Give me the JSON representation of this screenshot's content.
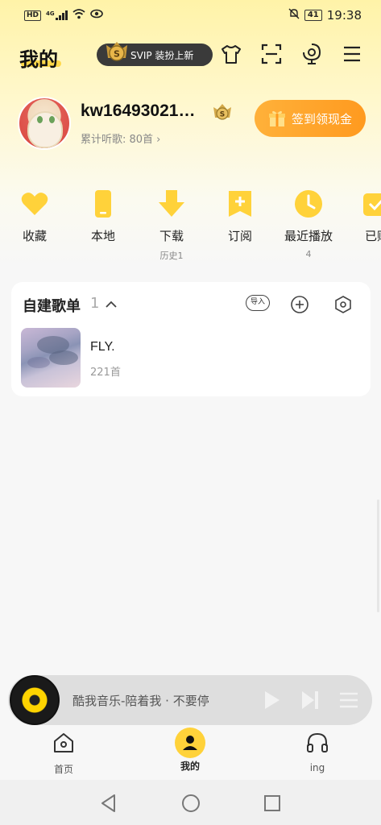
{
  "status_bar": {
    "left_icons": [
      "hd-icon",
      "4g-signal-icon",
      "wifi-icon",
      "eye-icon"
    ],
    "network_label": "4G",
    "hd_label": "HD",
    "battery": "41",
    "time": "19:38"
  },
  "header": {
    "title": "我的",
    "svip_promo": "SVIP 装扮上新",
    "icons": [
      "tshirt-icon",
      "scan-icon",
      "voice-assistant-icon",
      "menu-icon"
    ]
  },
  "profile": {
    "username": "kw16493021…",
    "listened": "累计听歌: 80首 ›",
    "signin_label": "签到领现金"
  },
  "quick_actions": [
    {
      "label": "收藏",
      "sub": "",
      "icon": "heart-icon"
    },
    {
      "label": "本地",
      "sub": "",
      "icon": "phone-icon"
    },
    {
      "label": "下载",
      "sub": "历史1",
      "icon": "download-icon"
    },
    {
      "label": "订阅",
      "sub": "",
      "icon": "subscribe-icon"
    },
    {
      "label": "最近播放",
      "sub": "4",
      "icon": "clock-icon"
    },
    {
      "label": "已购",
      "sub": "",
      "icon": "purchased-icon"
    }
  ],
  "playlists_section": {
    "title": "自建歌单",
    "count": "1",
    "import_label": "导入",
    "items": [
      {
        "name": "FLY.",
        "count": "221首"
      }
    ]
  },
  "player": {
    "text": "酷我音乐-陪着我 · 不要停"
  },
  "tabs": [
    {
      "label": "首页",
      "icon": "home-icon"
    },
    {
      "label": "我的",
      "icon": "profile-icon"
    },
    {
      "label": "ing",
      "icon": "headphones-icon"
    }
  ],
  "colors": {
    "accent": "#ffd84a",
    "icon_yellow": "#ffd23a",
    "signin_orange": "#ffa52b"
  }
}
